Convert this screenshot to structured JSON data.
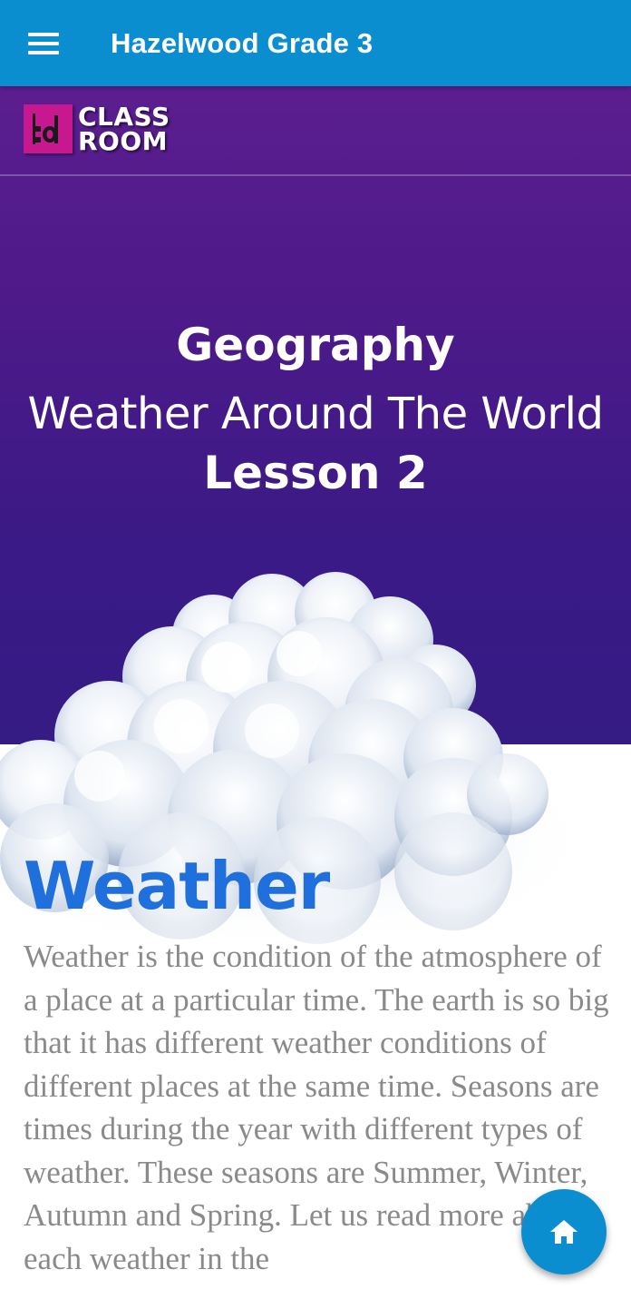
{
  "app_bar": {
    "title": "Hazelwood Grade 3",
    "menu_icon": "hamburger-menu-icon",
    "background_color": "#0a8ecf"
  },
  "hero": {
    "logo": {
      "line1": "CLASS",
      "line2": "ROOM",
      "mark_color": "#c7188f"
    },
    "subject": "Geography",
    "topic": "Weather Around The World",
    "lesson": "Lesson 2",
    "background_color": "#4a1a8a"
  },
  "content": {
    "heading": "Weather",
    "heading_color": "#1f6fdc",
    "paragraph": "Weather is the condition of the atmosphere of a place at a particular time. The earth is so big that it has different weather conditions of different places at the same time. Seasons are times during the year with different types of weather. These seasons are Summer, Winter, Autumn and Spring. Let us read more about each weather in the"
  },
  "fab": {
    "icon": "home-icon"
  }
}
